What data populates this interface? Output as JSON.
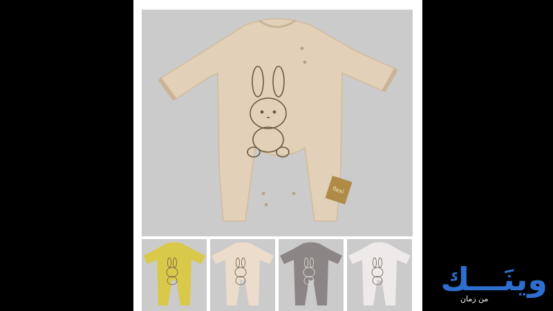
{
  "product": {
    "main_color": "#e2d0b8",
    "tag_text": "flexi",
    "print_name": "bunny-print"
  },
  "thumbnails": [
    {
      "name": "yellow",
      "color": "#d9c94a"
    },
    {
      "name": "cream",
      "color": "#ecdccb"
    },
    {
      "name": "grey",
      "color": "#8c8585"
    },
    {
      "name": "white",
      "color": "#efeaea"
    }
  ],
  "logo": {
    "text": "وينَـــك",
    "subtitle": "من زمان",
    "color": "#2d6fcf"
  }
}
